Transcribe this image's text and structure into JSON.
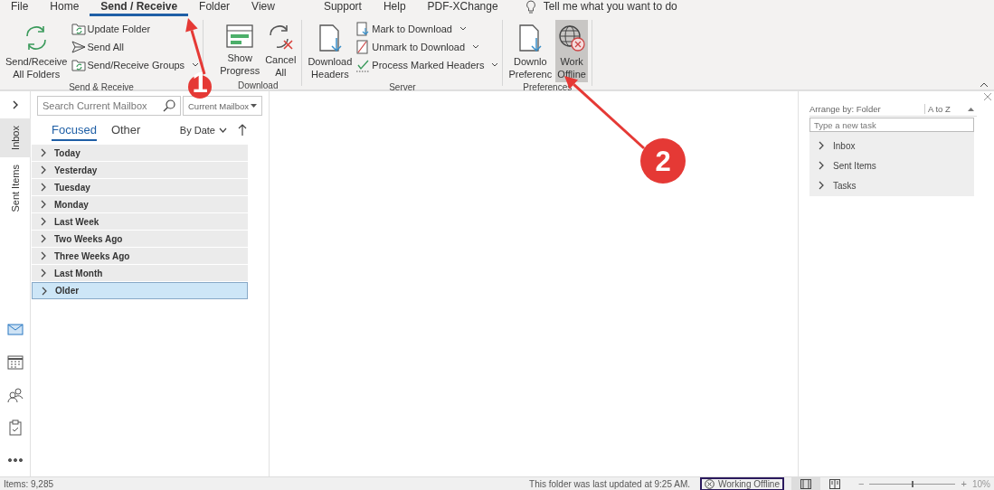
{
  "menu_tabs": [
    {
      "label": "File",
      "selected": false
    },
    {
      "label": "Home",
      "selected": false
    },
    {
      "label": "Send / Receive",
      "selected": true
    },
    {
      "label": "Folder",
      "selected": false
    },
    {
      "label": "View",
      "selected": false
    },
    {
      "label": "Support",
      "selected": false
    },
    {
      "label": "Help",
      "selected": false
    },
    {
      "label": "PDF-XChange",
      "selected": false
    }
  ],
  "tell_me": {
    "placeholder": "Tell me what you want to do"
  },
  "ribbon_groups": [
    {
      "label": "Send & Receive",
      "large_buttons": [
        {
          "lines": [
            "Send/Receive",
            "All Folders"
          ],
          "selected": false
        }
      ],
      "small_buttons": [
        {
          "label": "Update Folder",
          "dropdown": false
        },
        {
          "label": "Send All",
          "dropdown": false
        },
        {
          "label": "Send/Receive Groups",
          "dropdown": true
        }
      ]
    },
    {
      "label": "Download",
      "large_buttons": [
        {
          "lines": [
            "Show",
            "Progress"
          ],
          "selected": false
        },
        {
          "lines": [
            "Cancel",
            "All"
          ],
          "selected": false
        }
      ]
    },
    {
      "label": "Server",
      "large_buttons": [
        {
          "lines": [
            "Download",
            "Headers"
          ],
          "selected": false
        }
      ],
      "small_buttons": [
        {
          "label": "Mark to Download",
          "dropdown": true
        },
        {
          "label": "Unmark to Download",
          "dropdown": true
        },
        {
          "label": "Process Marked Headers",
          "dropdown": true
        }
      ]
    },
    {
      "label": "Preferences",
      "large_buttons": [
        {
          "lines": [
            "Downlo",
            "Preferenc"
          ],
          "selected": false
        },
        {
          "lines": [
            "Work",
            "Offline"
          ],
          "selected": true
        }
      ]
    }
  ],
  "side_tabs": [
    {
      "label": "Inbox",
      "selected": true
    },
    {
      "label": "Sent Items",
      "selected": false
    }
  ],
  "nav_icons": [
    {
      "kind": "mail",
      "selected": true
    },
    {
      "kind": "calendar",
      "selected": false
    },
    {
      "kind": "people",
      "selected": false
    },
    {
      "kind": "tasks",
      "selected": false
    },
    {
      "kind": "more",
      "selected": false
    }
  ],
  "search": {
    "placeholder": "Search Current Mailbox",
    "scope": "Current Mailbox"
  },
  "list_tabs": [
    {
      "label": "Focused",
      "selected": true
    },
    {
      "label": "Other",
      "selected": false
    }
  ],
  "sort": {
    "label": "By Date"
  },
  "groups": [
    {
      "label": "Today",
      "selected": false
    },
    {
      "label": "Yesterday",
      "selected": false
    },
    {
      "label": "Tuesday",
      "selected": false
    },
    {
      "label": "Monday",
      "selected": false
    },
    {
      "label": "Last Week",
      "selected": false
    },
    {
      "label": "Two Weeks Ago",
      "selected": false
    },
    {
      "label": "Three Weeks Ago",
      "selected": false
    },
    {
      "label": "Last Month",
      "selected": false
    },
    {
      "label": "Older",
      "selected": true
    }
  ],
  "task_pane": {
    "arrange": "Arrange by: Folder",
    "order": "A to Z",
    "new_task": {
      "placeholder": "Type a new task"
    },
    "groups": [
      {
        "label": "Inbox"
      },
      {
        "label": "Sent Items"
      },
      {
        "label": "Tasks"
      }
    ]
  },
  "status_bar": {
    "items": "Items: 9,285",
    "updated": "This folder was last updated at 9:25 AM.",
    "offline": "Working Offline",
    "zoom": {
      "zoom_out": "−",
      "level": 0.5,
      "zoom_in": "+",
      "reading": "10%"
    }
  },
  "annotations": [
    {
      "label": "1"
    },
    {
      "label": "2"
    }
  ]
}
